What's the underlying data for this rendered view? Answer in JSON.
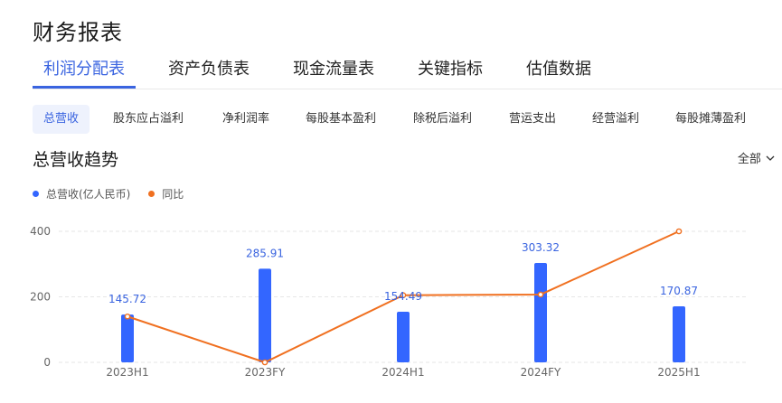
{
  "page_title": "财务报表",
  "main_tabs": [
    {
      "label": "利润分配表",
      "active": true
    },
    {
      "label": "资产负债表",
      "active": false
    },
    {
      "label": "现金流量表",
      "active": false
    },
    {
      "label": "关键指标",
      "active": false
    },
    {
      "label": "估值数据",
      "active": false
    }
  ],
  "sub_tabs": [
    {
      "label": "总营收",
      "active": true
    },
    {
      "label": "股东应占溢利",
      "active": false
    },
    {
      "label": "净利润率",
      "active": false
    },
    {
      "label": "每股基本盈利",
      "active": false
    },
    {
      "label": "除税后溢利",
      "active": false
    },
    {
      "label": "营运支出",
      "active": false
    },
    {
      "label": "经营溢利",
      "active": false
    },
    {
      "label": "每股摊薄盈利",
      "active": false
    }
  ],
  "section_title": "总营收趋势",
  "range_select": {
    "label": "全部",
    "icon": "chevron-down-icon"
  },
  "colors": {
    "accent": "#3a64e0",
    "bar": "#3366ff",
    "line": "#f07020",
    "label": "#3a64e0"
  },
  "chart_data": {
    "type": "bar",
    "categories": [
      "2023H1",
      "2023FY",
      "2024H1",
      "2024FY",
      "2025H1"
    ],
    "series": [
      {
        "name": "总营收(亿人民币)",
        "type": "bar",
        "values": [
          145.72,
          285.91,
          154.49,
          303.32,
          170.87
        ]
      },
      {
        "name": "同比",
        "type": "line",
        "values": [
          140,
          0,
          205,
          207,
          400
        ]
      }
    ],
    "y_ticks": [
      0,
      200,
      400
    ],
    "ylim": [
      0,
      400
    ],
    "grid": true,
    "legend": "top-left"
  }
}
